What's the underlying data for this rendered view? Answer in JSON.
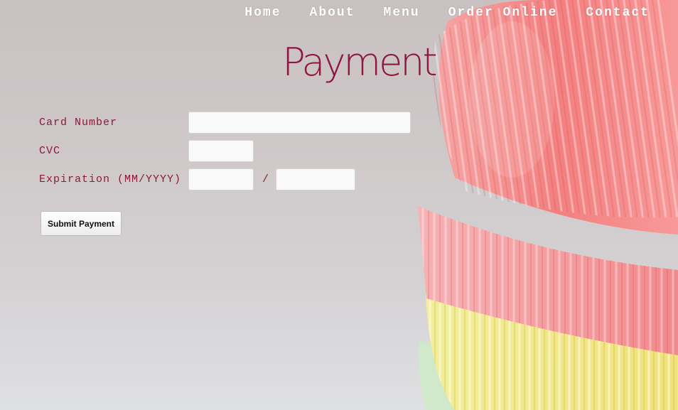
{
  "nav": {
    "items": [
      {
        "label": "Home"
      },
      {
        "label": "About"
      },
      {
        "label": "Menu"
      },
      {
        "label": "Order Online"
      },
      {
        "label": "Contact"
      }
    ]
  },
  "page": {
    "title": "Payment"
  },
  "form": {
    "card_number": {
      "label": "Card Number",
      "value": "",
      "placeholder": ""
    },
    "cvc": {
      "label": "CVC",
      "value": "",
      "placeholder": ""
    },
    "expiration": {
      "label": "Expiration (MM/YYYY)",
      "separator": "/",
      "month_value": "",
      "year_value": ""
    },
    "submit_label": "Submit Payment"
  },
  "colors": {
    "accent": "#8f1740",
    "nav_text": "#ffffff",
    "background": "#cfc9ca"
  }
}
